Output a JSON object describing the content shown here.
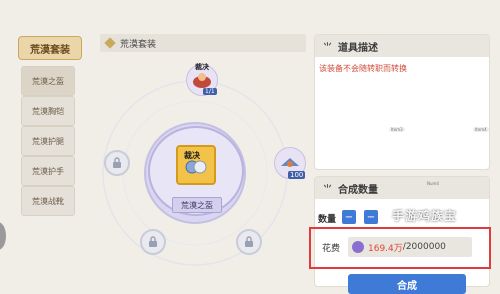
{
  "sidebar": {
    "header_label": "荒漠套装",
    "items": [
      {
        "label": "荒漠之盔"
      },
      {
        "label": "荒漠胸铠"
      },
      {
        "label": "荒漠护腿"
      },
      {
        "label": "荒漠护手"
      },
      {
        "label": "荒漠战靴"
      }
    ]
  },
  "center": {
    "title": "荒漠套装",
    "main_item": {
      "label": "荒漠之盔",
      "tag": "裁决"
    },
    "top_item": {
      "tag": "裁决",
      "count": "1/1"
    },
    "right_item": {
      "count": "100"
    }
  },
  "desc_panel": {
    "title": "道具描述",
    "text": "该装备不会随转职而转换"
  },
  "craft_panel": {
    "title": "合成数量",
    "qty_label": "数量",
    "cost_label": "花费",
    "cost_current": "169.4万",
    "cost_sep": "/",
    "cost_total": "2000000",
    "craft_button": "合成"
  },
  "misc": {
    "tiny_labels": [
      "Item3",
      "Item4",
      "Num4"
    ],
    "watermark": "手游鸡族宝"
  },
  "colors": {
    "accent_blue": "#3f7ad6",
    "highlight_red": "#e23b3b",
    "cost_red": "#e0463a",
    "gold": "#c9a860"
  }
}
